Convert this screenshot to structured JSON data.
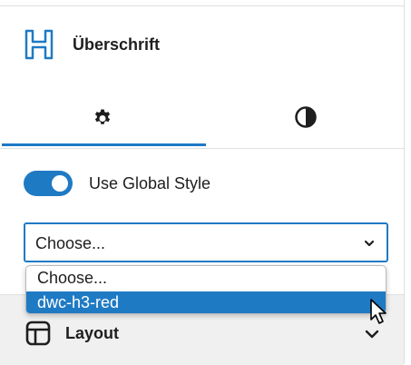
{
  "block": {
    "title": "Überschrift",
    "icon": "heading-block-icon"
  },
  "tabs": [
    {
      "name": "settings",
      "icon": "gear-icon",
      "active": true
    },
    {
      "name": "styles",
      "icon": "half-circle-contrast-icon",
      "active": false
    }
  ],
  "global_style": {
    "label": "Use Global Style",
    "enabled": true
  },
  "style_select": {
    "value": "Choose...",
    "options": [
      "Choose...",
      "dwc-h3-red"
    ],
    "highlighted": "dwc-h3-red"
  },
  "layout_panel": {
    "title": "Layout",
    "icon": "layout-icon",
    "expanded": false
  },
  "colors": {
    "accent": "#1f7ac4",
    "panel_bg": "#f0f0f0",
    "text": "#1e1e1e"
  }
}
